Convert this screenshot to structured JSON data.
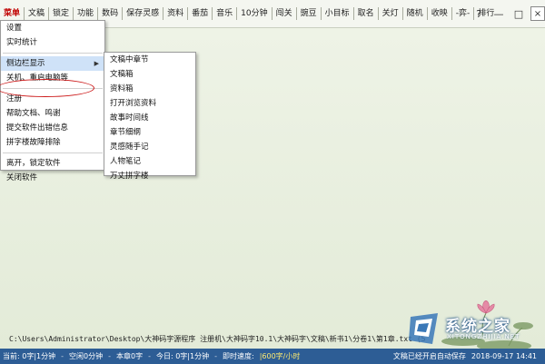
{
  "menubar": {
    "items": [
      "菜单",
      "文稿",
      "锁定",
      "功能",
      "数码",
      "保存灵感",
      "资料",
      "番茄",
      "音乐",
      "10分钟",
      "闯关",
      "豌豆",
      "小目标",
      "取名",
      "关灯",
      "随机",
      "收映",
      "-弈-",
      "排行"
    ]
  },
  "window_controls": {
    "help": "?",
    "minimize": "—",
    "maximize": "□",
    "close": "×"
  },
  "main_menu": {
    "items": [
      "设置",
      "实时统计",
      "侧边栏显示",
      "关机、重启电脑等",
      "注册",
      "帮助文档、鸣谢",
      "提交软件出错信息",
      "拼字楼故障排除",
      "离开，锁定软件",
      "关闭软件"
    ]
  },
  "sub_menu": {
    "items": [
      "文稿中章节",
      "文稿箱",
      "资料箱",
      "打开浏览资料",
      "故事时间线",
      "章节细纲",
      "灵感随手记",
      "人物笔记",
      "万丈拼字楼"
    ]
  },
  "editor": {
    "path": "C:\\Users\\Administrator\\Desktop\\大神码字源程序 注册机\\大神码字10.1\\大神码字\\文稿\\新书1\\分卷1\\第1章.txt (5"
  },
  "status": {
    "current": "当前: 0字|1分钟",
    "idle": "空闲0分钟",
    "chapter": "本章0字",
    "today": "今日: 0字|1分钟",
    "speed_label": "即时速度:",
    "speed": "|600字/小时",
    "saved": "文稿已经开启自动保存",
    "datetime": "2018-09-17 14:41"
  },
  "watermark": {
    "text": "系统之家",
    "sub": "XITONGZHIJIA.NET"
  },
  "colors": {
    "accent_red": "#c00000",
    "status_blue": "#2d5d95",
    "highlight": "#cfe2f8"
  }
}
